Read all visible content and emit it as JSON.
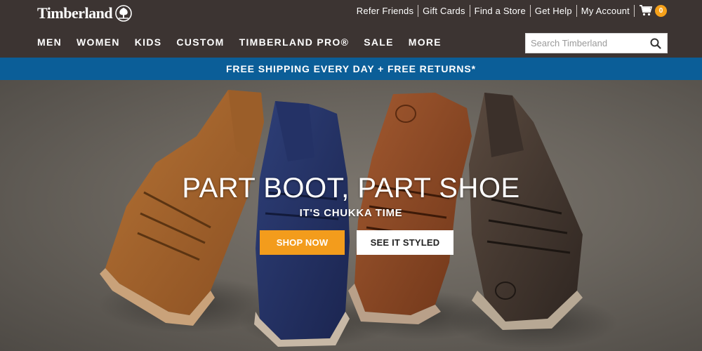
{
  "brand": {
    "name": "Timberland"
  },
  "utility_nav": {
    "links": [
      "Refer Friends",
      "Gift Cards",
      "Find a Store",
      "Get Help",
      "My Account"
    ],
    "cart_count": "0"
  },
  "main_nav": {
    "items": [
      "MEN",
      "WOMEN",
      "KIDS",
      "CUSTOM",
      "TIMBERLAND PRO®",
      "SALE",
      "MORE"
    ]
  },
  "search": {
    "placeholder": "Search Timberland",
    "value": ""
  },
  "promo": {
    "text": "FREE SHIPPING EVERY DAY + FREE RETURNS*"
  },
  "hero": {
    "title": "PART BOOT, PART SHOE",
    "subtitle": "IT'S CHUKKA TIME",
    "shop_label": "SHOP NOW",
    "style_label": "SEE IT STYLED"
  },
  "colors": {
    "header_bg": "#3c3432",
    "promo_bg": "#0b5e98",
    "accent_orange": "#f39c1c",
    "cart_badge": "#f5a01a"
  }
}
